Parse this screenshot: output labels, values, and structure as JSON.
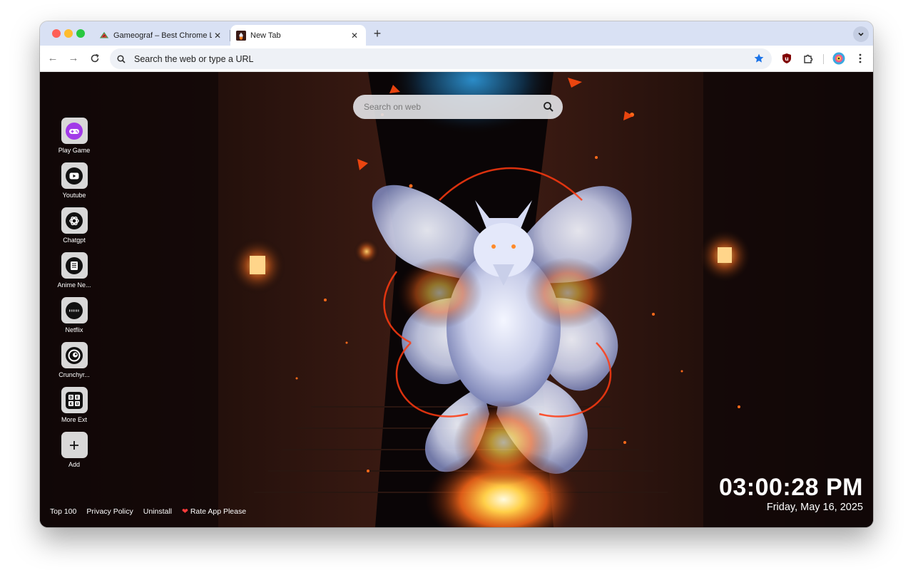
{
  "tabs": [
    {
      "title": "Gameograf – Best Chrome Li",
      "active": false,
      "favicon": "watermelon-icon"
    },
    {
      "title": "New Tab",
      "active": true,
      "favicon": "fox-thumbnail-icon"
    }
  ],
  "toolbar": {
    "address_placeholder": "Search the web or type a URL",
    "icons": [
      "back-arrow-icon",
      "forward-arrow-icon",
      "reload-icon",
      "star-icon",
      "ublock-icon",
      "extensions-puzzle-icon",
      "profile-avatar-icon",
      "kebab-menu-icon"
    ]
  },
  "page": {
    "search_placeholder": "Search on web",
    "shortcuts": [
      {
        "label": "Play Game",
        "icon": "gamepad-icon"
      },
      {
        "label": "Youtube",
        "icon": "youtube-icon"
      },
      {
        "label": "Chatgpt",
        "icon": "openai-icon"
      },
      {
        "label": "Anime Ne...",
        "icon": "newspaper-icon"
      },
      {
        "label": "Netflix",
        "icon": "netflix-icon"
      },
      {
        "label": "Crunchyr...",
        "icon": "crunchyroll-icon"
      },
      {
        "label": "More Ext",
        "icon": "dekku-grid-icon"
      },
      {
        "label": "Add",
        "icon": "plus-icon"
      }
    ],
    "footer_links": [
      "Top 100",
      "Privacy Policy",
      "Uninstall",
      "Rate App Please"
    ],
    "clock_time": "03:00:28 PM",
    "clock_date": "Friday, May 16, 2025"
  },
  "colors": {
    "tabstrip_bg": "#d9e1f4",
    "omnibox_bg": "#eef1f6",
    "star_blue": "#1a73e8",
    "accent_purple": "#a23be8",
    "fire_orange": "#ff6a1a"
  }
}
